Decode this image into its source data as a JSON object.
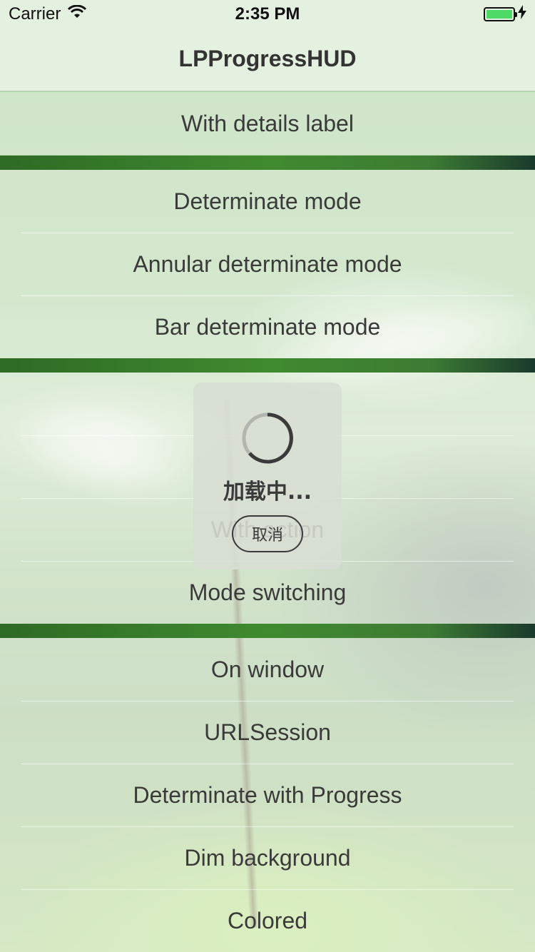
{
  "status_bar": {
    "carrier": "Carrier",
    "time": "2:35 PM",
    "icons": [
      "wifi-icon",
      "battery-icon",
      "charging-bolt-icon"
    ],
    "battery_color": "#4cd964"
  },
  "nav": {
    "title": "LPProgressHUD"
  },
  "sections": [
    {
      "rows": [
        "With details label"
      ]
    },
    {
      "rows": [
        "Determinate mode",
        "Annular determinate mode",
        "Bar determinate mode"
      ]
    },
    {
      "rows": [
        "",
        "",
        "With action",
        "Mode switching"
      ]
    },
    {
      "rows": [
        "On window",
        "URLSession",
        "Determinate with Progress",
        "Dim background",
        "Colored"
      ]
    }
  ],
  "hud": {
    "label": "加载中...",
    "cancel_label": "取消",
    "icon": "spinner-icon"
  }
}
